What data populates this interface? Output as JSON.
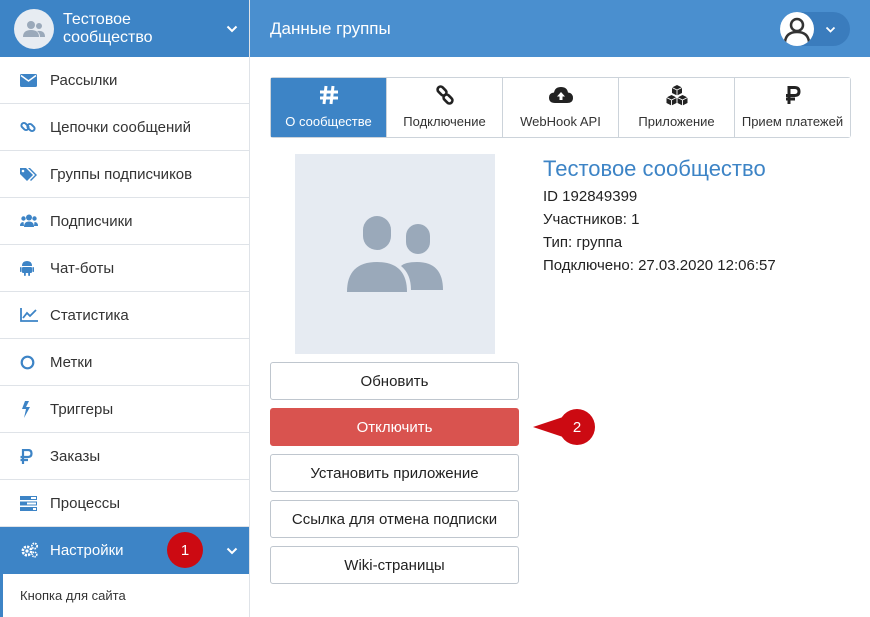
{
  "sidebar": {
    "community_name": "Тестовое сообщество",
    "items": [
      {
        "label": "Рассылки",
        "icon": "envelope-icon"
      },
      {
        "label": "Цепочки сообщений",
        "icon": "link-icon"
      },
      {
        "label": "Группы подписчиков",
        "icon": "tags-icon"
      },
      {
        "label": "Подписчики",
        "icon": "users-icon"
      },
      {
        "label": "Чат-боты",
        "icon": "android-icon"
      },
      {
        "label": "Статистика",
        "icon": "line-chart-icon"
      },
      {
        "label": "Метки",
        "icon": "circle-icon"
      },
      {
        "label": "Триггеры",
        "icon": "bolt-icon"
      },
      {
        "label": "Заказы",
        "icon": "ruble-icon"
      },
      {
        "label": "Процессы",
        "icon": "tasks-icon"
      }
    ],
    "settings": {
      "label": "Настройки",
      "icon": "cogs-icon",
      "marker": "1"
    },
    "submenu": {
      "label": "Кнопка для сайта"
    }
  },
  "topbar": {
    "title": "Данные группы"
  },
  "tabs": [
    {
      "label": "О сообществе",
      "icon": "hashtag-icon",
      "active": true
    },
    {
      "label": "Подключение",
      "icon": "link-icon",
      "active": false
    },
    {
      "label": "WebHook API",
      "icon": "cloud-upload-icon",
      "active": false
    },
    {
      "label": "Приложение",
      "icon": "cubes-icon",
      "active": false
    },
    {
      "label": "Прием платежей",
      "icon": "ruble-icon",
      "active": false
    }
  ],
  "group": {
    "name": "Тестовое сообщество",
    "id_line": "ID 192849399",
    "members_line": "Участников: 1",
    "type_line": "Тип: группа",
    "connected_line": "Подключено: 27.03.2020 12:06:57"
  },
  "buttons": {
    "refresh": "Обновить",
    "disconnect": "Отключить",
    "install_app": "Установить приложение",
    "unsubscribe_link": "Ссылка для отмена подписки",
    "wiki": "Wiki-страницы"
  },
  "annotations": {
    "marker_2": "2"
  },
  "colors": {
    "primary": "#3d84c6",
    "danger": "#d9534f",
    "marker": "#cc0a12"
  }
}
